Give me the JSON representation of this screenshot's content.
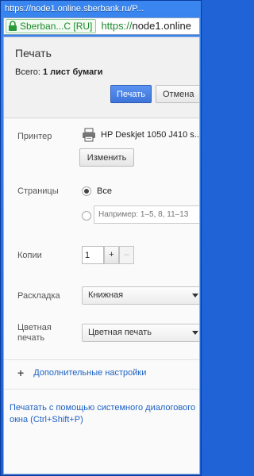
{
  "window": {
    "title": "https://node1.online.sberbank.ru/P..."
  },
  "address_bar": {
    "security_label": "Sberban...C [RU]",
    "url_scheme": "https://",
    "url_rest": "node1.online"
  },
  "print_dialog": {
    "title": "Печать",
    "summary_label": "Всего:",
    "summary_value": "1 лист бумаги",
    "print_button": "Печать",
    "cancel_button": "Отмена",
    "printer_label": "Принтер",
    "printer_name": "HP Deskjet 1050 J410 s...",
    "change_button": "Изменить",
    "pages_label": "Страницы",
    "pages_all": "Все",
    "pages_placeholder": "Например: 1–5, 8, 11–13",
    "copies_label": "Копии",
    "copies_value": "1",
    "copies_increment": "+",
    "copies_decrement": "–",
    "layout_label": "Раскладка",
    "layout_value": "Книжная",
    "color_label_line1": "Цветная",
    "color_label_line2": "печать",
    "color_value": "Цветная печать",
    "advanced_link": "Дополнительные настройки",
    "advanced_plus": "+",
    "system_dialog_link": "Печатать с помощью системного диалогового окна (Ctrl+Shift+P)"
  },
  "colors": {
    "accent_blue": "#3d74d8",
    "link_blue": "#1e62c4",
    "secure_green": "#1b8a2b"
  },
  "icons": {
    "lock": "lock-icon",
    "printer": "printer-icon",
    "dropdown": "chevron-down-icon"
  }
}
